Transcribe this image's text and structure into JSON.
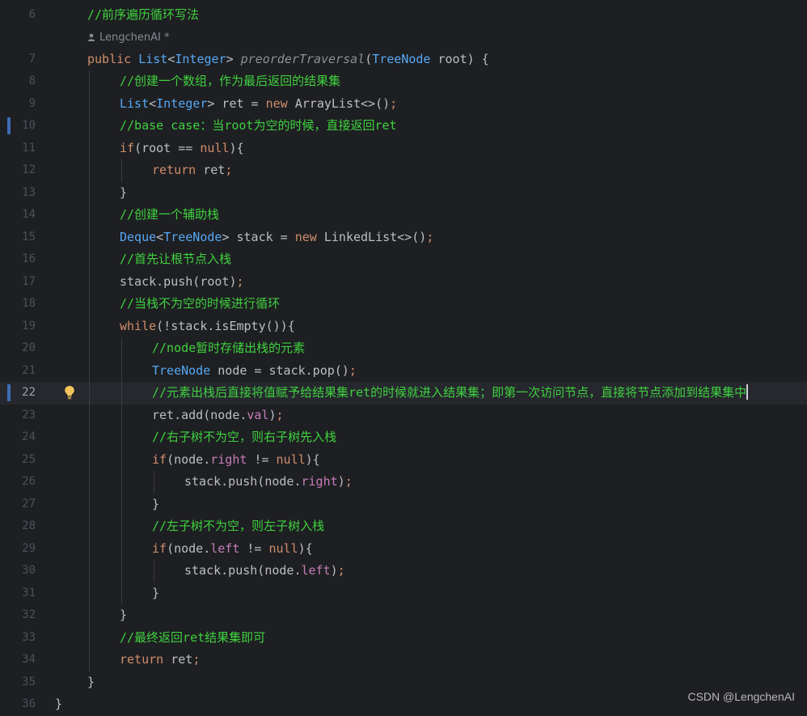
{
  "author": "LengchenAI *",
  "watermark": "CSDN @LengchenAI",
  "lines": [
    {
      "num": "6",
      "indent": 1,
      "tokens": [
        [
          "cm",
          "//前序遍历循环写法"
        ]
      ]
    },
    {
      "author": true
    },
    {
      "num": "7",
      "indent": 1,
      "tokens": [
        [
          "kw",
          "public "
        ],
        [
          "ty",
          "List"
        ],
        [
          "pl",
          "<"
        ],
        [
          "ty",
          "Integer"
        ],
        [
          "pl",
          "> "
        ],
        [
          "fn",
          "preorderTraversal"
        ],
        [
          "pl",
          "("
        ],
        [
          "ty",
          "TreeNode"
        ],
        [
          "pl",
          " root) {"
        ]
      ]
    },
    {
      "num": "8",
      "indent": 2,
      "tokens": [
        [
          "cm",
          "//创建一个数组，作为最后返回的结果集"
        ]
      ]
    },
    {
      "num": "9",
      "indent": 2,
      "tokens": [
        [
          "ty",
          "List"
        ],
        [
          "pl",
          "<"
        ],
        [
          "ty",
          "Integer"
        ],
        [
          "pl",
          "> ret = "
        ],
        [
          "kw",
          "new "
        ],
        [
          "pl",
          "ArrayList<>()"
        ],
        [
          "kw",
          ";"
        ]
      ]
    },
    {
      "num": "10",
      "indent": 2,
      "mark": true,
      "tokens": [
        [
          "cm",
          "//base case：当root为空的时候，直接返回ret"
        ]
      ]
    },
    {
      "num": "11",
      "indent": 2,
      "tokens": [
        [
          "kw",
          "if"
        ],
        [
          "pl",
          "(root == "
        ],
        [
          "kw",
          "null"
        ],
        [
          "pl",
          "){"
        ]
      ]
    },
    {
      "num": "12",
      "indent": 3,
      "tokens": [
        [
          "kw",
          "return "
        ],
        [
          "pl",
          "ret"
        ],
        [
          "kw",
          ";"
        ]
      ]
    },
    {
      "num": "13",
      "indent": 2,
      "tokens": [
        [
          "pl",
          "}"
        ]
      ]
    },
    {
      "num": "14",
      "indent": 2,
      "tokens": [
        [
          "cm",
          "//创建一个辅助栈"
        ]
      ]
    },
    {
      "num": "15",
      "indent": 2,
      "tokens": [
        [
          "ty",
          "Deque"
        ],
        [
          "pl",
          "<"
        ],
        [
          "ty",
          "TreeNode"
        ],
        [
          "pl",
          "> stack = "
        ],
        [
          "kw",
          "new "
        ],
        [
          "pl",
          "LinkedList<>()"
        ],
        [
          "kw",
          ";"
        ]
      ]
    },
    {
      "num": "16",
      "indent": 2,
      "tokens": [
        [
          "cm",
          "//首先让根节点入栈"
        ]
      ]
    },
    {
      "num": "17",
      "indent": 2,
      "tokens": [
        [
          "pl",
          "stack.push(root)"
        ],
        [
          "kw",
          ";"
        ]
      ]
    },
    {
      "num": "18",
      "indent": 2,
      "tokens": [
        [
          "cm",
          "//当栈不为空的时候进行循环"
        ]
      ]
    },
    {
      "num": "19",
      "indent": 2,
      "tokens": [
        [
          "kw",
          "while"
        ],
        [
          "pl",
          "(!stack.isEmpty()){"
        ]
      ]
    },
    {
      "num": "20",
      "indent": 3,
      "tokens": [
        [
          "cm",
          "//node暂时存储出栈的元素"
        ]
      ]
    },
    {
      "num": "21",
      "indent": 3,
      "tokens": [
        [
          "ty",
          "TreeNode"
        ],
        [
          "pl",
          " node = stack.pop()"
        ],
        [
          "kw",
          ";"
        ]
      ]
    },
    {
      "num": "22",
      "indent": 3,
      "current": true,
      "mark": true,
      "bulb": true,
      "caret": true,
      "tokens": [
        [
          "cm",
          "//元素出栈后直接将值赋予给结果集ret的时候就进入结果集；即第一次访问节点，直接将节点添加到结果集中"
        ]
      ]
    },
    {
      "num": "23",
      "indent": 3,
      "tokens": [
        [
          "pl",
          "ret.add(node."
        ],
        [
          "fld",
          "val"
        ],
        [
          "pl",
          ")"
        ],
        [
          "kw",
          ";"
        ]
      ]
    },
    {
      "num": "24",
      "indent": 3,
      "tokens": [
        [
          "cm",
          "//右子树不为空，则右子树先入栈"
        ]
      ]
    },
    {
      "num": "25",
      "indent": 3,
      "tokens": [
        [
          "kw",
          "if"
        ],
        [
          "pl",
          "(node."
        ],
        [
          "fld",
          "right"
        ],
        [
          "pl",
          " != "
        ],
        [
          "kw",
          "null"
        ],
        [
          "pl",
          "){"
        ]
      ]
    },
    {
      "num": "26",
      "indent": 4,
      "tokens": [
        [
          "pl",
          "stack.push(node."
        ],
        [
          "fld",
          "right"
        ],
        [
          "pl",
          ")"
        ],
        [
          "kw",
          ";"
        ]
      ]
    },
    {
      "num": "27",
      "indent": 3,
      "tokens": [
        [
          "pl",
          "}"
        ]
      ]
    },
    {
      "num": "28",
      "indent": 3,
      "tokens": [
        [
          "cm",
          "//左子树不为空，则左子树入栈"
        ]
      ]
    },
    {
      "num": "29",
      "indent": 3,
      "tokens": [
        [
          "kw",
          "if"
        ],
        [
          "pl",
          "(node."
        ],
        [
          "fld",
          "left"
        ],
        [
          "pl",
          " != "
        ],
        [
          "kw",
          "null"
        ],
        [
          "pl",
          "){"
        ]
      ]
    },
    {
      "num": "30",
      "indent": 4,
      "tokens": [
        [
          "pl",
          "stack.push(node."
        ],
        [
          "fld",
          "left"
        ],
        [
          "pl",
          ")"
        ],
        [
          "kw",
          ";"
        ]
      ]
    },
    {
      "num": "31",
      "indent": 3,
      "tokens": [
        [
          "pl",
          "}"
        ]
      ]
    },
    {
      "num": "32",
      "indent": 2,
      "tokens": [
        [
          "pl",
          "}"
        ]
      ]
    },
    {
      "num": "33",
      "indent": 2,
      "tokens": [
        [
          "cm",
          "//最终返回ret结果集即可"
        ]
      ]
    },
    {
      "num": "34",
      "indent": 2,
      "tokens": [
        [
          "kw",
          "return "
        ],
        [
          "pl",
          "ret"
        ],
        [
          "kw",
          ";"
        ]
      ]
    },
    {
      "num": "35",
      "indent": 1,
      "tokens": [
        [
          "pl",
          "}"
        ]
      ]
    },
    {
      "num": "36",
      "indent": 0,
      "tokens": [
        [
          "pl",
          "}"
        ]
      ]
    }
  ]
}
